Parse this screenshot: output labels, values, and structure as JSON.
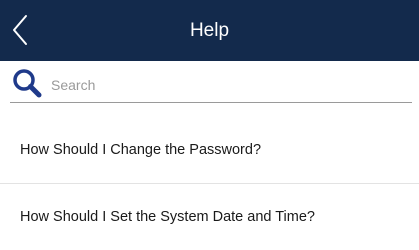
{
  "header": {
    "title": "Help",
    "back_icon": "chevron-left-icon",
    "background_color": "#132a4c"
  },
  "search": {
    "placeholder": "Search",
    "value": "",
    "icon": "search-icon",
    "icon_color": "#1f3a8a"
  },
  "help_items": [
    {
      "label": "How Should I Change the Password?"
    },
    {
      "label": "How Should I Set the System Date and Time?"
    }
  ]
}
